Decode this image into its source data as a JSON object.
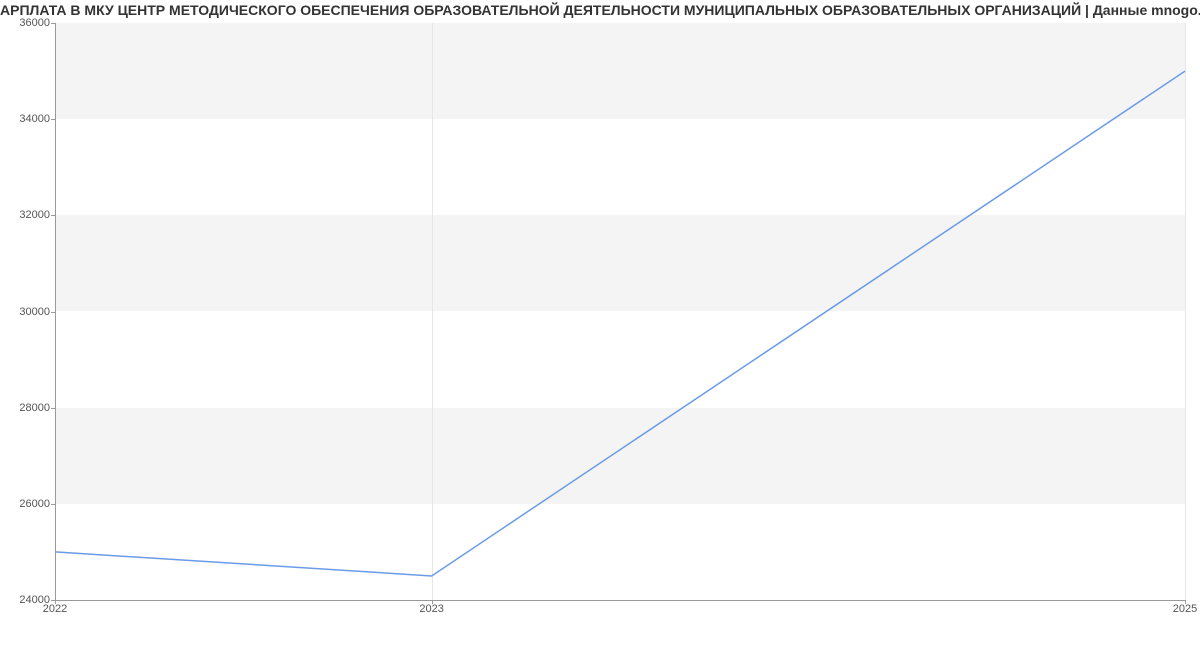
{
  "chart_data": {
    "type": "line",
    "title": "АРПЛАТА В МКУ ЦЕНТР МЕТОДИЧЕСКОГО ОБЕСПЕЧЕНИЯ ОБРАЗОВАТЕЛЬНОЙ ДЕЯТЕЛЬНОСТИ МУНИЦИПАЛЬНЫХ ОБРАЗОВАТЕЛЬНЫХ ОРГАНИЗАЦИЙ | Данные mnogo.wor",
    "x": [
      2022,
      2023,
      2025
    ],
    "values": [
      25000,
      24500,
      35000
    ],
    "xlabel": "",
    "ylabel": "",
    "ylim": [
      24000,
      36000
    ],
    "xlim": [
      2022,
      2025
    ],
    "y_ticks": [
      24000,
      26000,
      28000,
      30000,
      32000,
      34000,
      36000
    ],
    "x_ticks": [
      2022,
      2023,
      2025
    ],
    "line_color": "#6b9be8"
  }
}
